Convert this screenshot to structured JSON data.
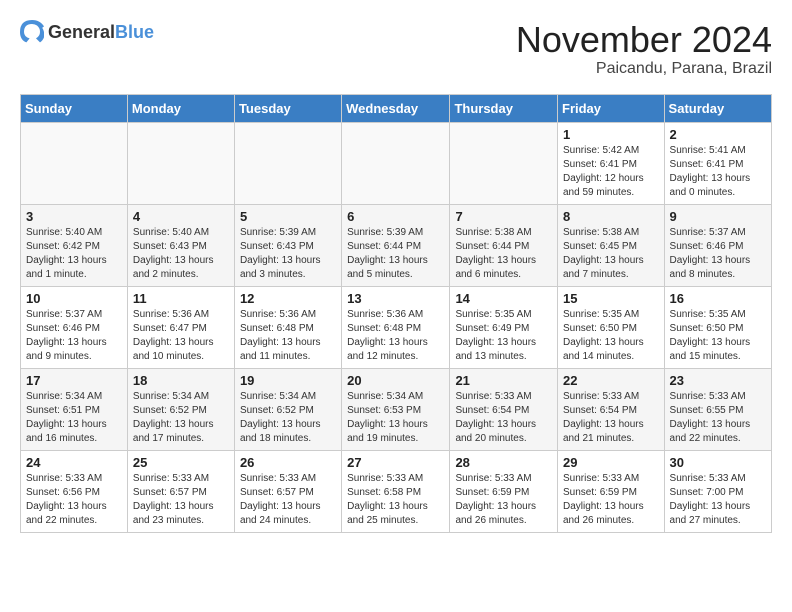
{
  "header": {
    "logo_general": "General",
    "logo_blue": "Blue",
    "month": "November 2024",
    "location": "Paicandu, Parana, Brazil"
  },
  "weekdays": [
    "Sunday",
    "Monday",
    "Tuesday",
    "Wednesday",
    "Thursday",
    "Friday",
    "Saturday"
  ],
  "weeks": [
    [
      {
        "day": "",
        "info": ""
      },
      {
        "day": "",
        "info": ""
      },
      {
        "day": "",
        "info": ""
      },
      {
        "day": "",
        "info": ""
      },
      {
        "day": "",
        "info": ""
      },
      {
        "day": "1",
        "info": "Sunrise: 5:42 AM\nSunset: 6:41 PM\nDaylight: 12 hours and 59 minutes."
      },
      {
        "day": "2",
        "info": "Sunrise: 5:41 AM\nSunset: 6:41 PM\nDaylight: 13 hours and 0 minutes."
      }
    ],
    [
      {
        "day": "3",
        "info": "Sunrise: 5:40 AM\nSunset: 6:42 PM\nDaylight: 13 hours and 1 minute."
      },
      {
        "day": "4",
        "info": "Sunrise: 5:40 AM\nSunset: 6:43 PM\nDaylight: 13 hours and 2 minutes."
      },
      {
        "day": "5",
        "info": "Sunrise: 5:39 AM\nSunset: 6:43 PM\nDaylight: 13 hours and 3 minutes."
      },
      {
        "day": "6",
        "info": "Sunrise: 5:39 AM\nSunset: 6:44 PM\nDaylight: 13 hours and 5 minutes."
      },
      {
        "day": "7",
        "info": "Sunrise: 5:38 AM\nSunset: 6:44 PM\nDaylight: 13 hours and 6 minutes."
      },
      {
        "day": "8",
        "info": "Sunrise: 5:38 AM\nSunset: 6:45 PM\nDaylight: 13 hours and 7 minutes."
      },
      {
        "day": "9",
        "info": "Sunrise: 5:37 AM\nSunset: 6:46 PM\nDaylight: 13 hours and 8 minutes."
      }
    ],
    [
      {
        "day": "10",
        "info": "Sunrise: 5:37 AM\nSunset: 6:46 PM\nDaylight: 13 hours and 9 minutes."
      },
      {
        "day": "11",
        "info": "Sunrise: 5:36 AM\nSunset: 6:47 PM\nDaylight: 13 hours and 10 minutes."
      },
      {
        "day": "12",
        "info": "Sunrise: 5:36 AM\nSunset: 6:48 PM\nDaylight: 13 hours and 11 minutes."
      },
      {
        "day": "13",
        "info": "Sunrise: 5:36 AM\nSunset: 6:48 PM\nDaylight: 13 hours and 12 minutes."
      },
      {
        "day": "14",
        "info": "Sunrise: 5:35 AM\nSunset: 6:49 PM\nDaylight: 13 hours and 13 minutes."
      },
      {
        "day": "15",
        "info": "Sunrise: 5:35 AM\nSunset: 6:50 PM\nDaylight: 13 hours and 14 minutes."
      },
      {
        "day": "16",
        "info": "Sunrise: 5:35 AM\nSunset: 6:50 PM\nDaylight: 13 hours and 15 minutes."
      }
    ],
    [
      {
        "day": "17",
        "info": "Sunrise: 5:34 AM\nSunset: 6:51 PM\nDaylight: 13 hours and 16 minutes."
      },
      {
        "day": "18",
        "info": "Sunrise: 5:34 AM\nSunset: 6:52 PM\nDaylight: 13 hours and 17 minutes."
      },
      {
        "day": "19",
        "info": "Sunrise: 5:34 AM\nSunset: 6:52 PM\nDaylight: 13 hours and 18 minutes."
      },
      {
        "day": "20",
        "info": "Sunrise: 5:34 AM\nSunset: 6:53 PM\nDaylight: 13 hours and 19 minutes."
      },
      {
        "day": "21",
        "info": "Sunrise: 5:33 AM\nSunset: 6:54 PM\nDaylight: 13 hours and 20 minutes."
      },
      {
        "day": "22",
        "info": "Sunrise: 5:33 AM\nSunset: 6:54 PM\nDaylight: 13 hours and 21 minutes."
      },
      {
        "day": "23",
        "info": "Sunrise: 5:33 AM\nSunset: 6:55 PM\nDaylight: 13 hours and 22 minutes."
      }
    ],
    [
      {
        "day": "24",
        "info": "Sunrise: 5:33 AM\nSunset: 6:56 PM\nDaylight: 13 hours and 22 minutes."
      },
      {
        "day": "25",
        "info": "Sunrise: 5:33 AM\nSunset: 6:57 PM\nDaylight: 13 hours and 23 minutes."
      },
      {
        "day": "26",
        "info": "Sunrise: 5:33 AM\nSunset: 6:57 PM\nDaylight: 13 hours and 24 minutes."
      },
      {
        "day": "27",
        "info": "Sunrise: 5:33 AM\nSunset: 6:58 PM\nDaylight: 13 hours and 25 minutes."
      },
      {
        "day": "28",
        "info": "Sunrise: 5:33 AM\nSunset: 6:59 PM\nDaylight: 13 hours and 26 minutes."
      },
      {
        "day": "29",
        "info": "Sunrise: 5:33 AM\nSunset: 6:59 PM\nDaylight: 13 hours and 26 minutes."
      },
      {
        "day": "30",
        "info": "Sunrise: 5:33 AM\nSunset: 7:00 PM\nDaylight: 13 hours and 27 minutes."
      }
    ]
  ]
}
